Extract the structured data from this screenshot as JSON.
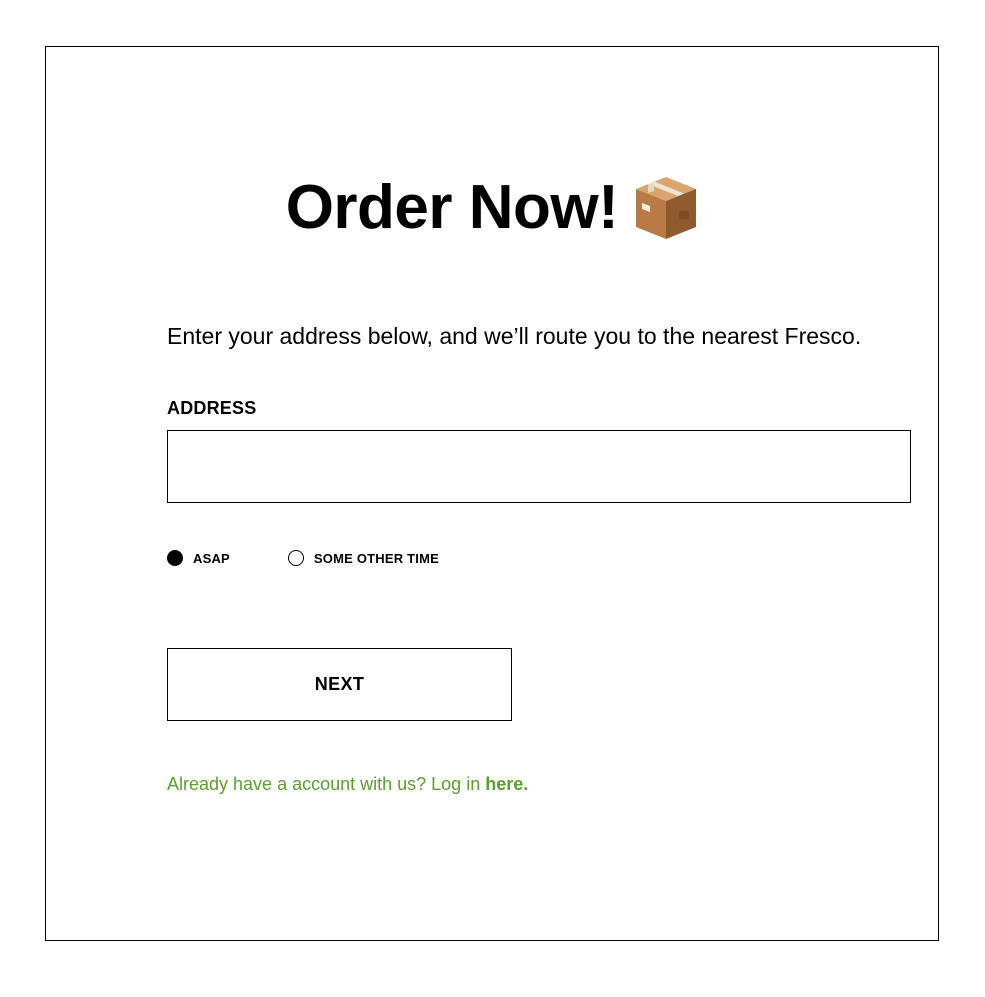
{
  "page": {
    "title": "Order Now!",
    "title_icon": "package-icon",
    "intro": "Enter your address below, and we’ll route you to the nearest Fresco."
  },
  "address": {
    "label": "ADDRESS",
    "value": "",
    "placeholder": ""
  },
  "timing": {
    "options": [
      {
        "label": "ASAP",
        "selected": true
      },
      {
        "label": "SOME OTHER TIME",
        "selected": false
      }
    ]
  },
  "actions": {
    "next_label": "NEXT"
  },
  "login": {
    "prompt": "Already have a account with us? Log in ",
    "link_label": "here."
  },
  "colors": {
    "text": "#000000",
    "link_green": "#5c9e2f",
    "border": "#000000",
    "background": "#ffffff",
    "box_brown": "#b97a46"
  }
}
